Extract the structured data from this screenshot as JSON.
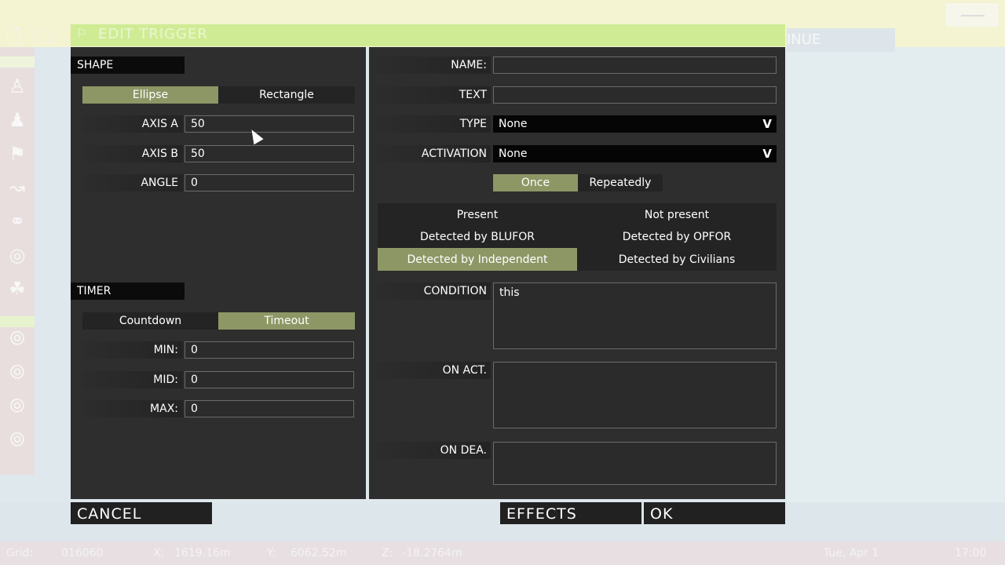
{
  "title": "EDIT TRIGGER",
  "continue_label": "INUE",
  "shape": {
    "header": "SHAPE",
    "toggle": [
      "Ellipse",
      "Rectangle"
    ],
    "axis_a": {
      "label": "AXIS A",
      "value": "50"
    },
    "axis_b": {
      "label": "AXIS B",
      "value": "50"
    },
    "angle": {
      "label": "ANGLE",
      "value": "0"
    }
  },
  "timer": {
    "header": "TIMER",
    "toggle": [
      "Countdown",
      "Timeout"
    ],
    "min": {
      "label": "MIN:",
      "value": "0"
    },
    "mid": {
      "label": "MID:",
      "value": "0"
    },
    "max": {
      "label": "MAX:",
      "value": "0"
    }
  },
  "right": {
    "name": {
      "label": "NAME:",
      "value": ""
    },
    "text": {
      "label": "TEXT",
      "value": ""
    },
    "type": {
      "label": "TYPE",
      "value": "None"
    },
    "activation": {
      "label": "ACTIVATION",
      "value": "None"
    },
    "repeat_toggle": [
      "Once",
      "Repeatedly"
    ],
    "conditions": [
      "Present",
      "Not present",
      "Detected by BLUFOR",
      "Detected by OPFOR",
      "Detected by Independent",
      "Detected by Civilians"
    ],
    "condition": {
      "label": "CONDITION",
      "value": "this"
    },
    "on_act": {
      "label": "ON ACT.",
      "value": ""
    },
    "on_dea": {
      "label": "ON DEA.",
      "value": ""
    }
  },
  "buttons": {
    "cancel": "CANCEL",
    "effects": "EFFECTS",
    "ok": "OK"
  },
  "status": {
    "grid_label": "Grid:",
    "grid_value": "016060",
    "x_label": "X:",
    "x_value": "1619.16m",
    "y_label": "Y:",
    "y_value": "6062.52m",
    "z_label": "Z:",
    "z_value": "-18.2764m",
    "date": "Tue, Apr 1",
    "time": "17:00"
  },
  "colors": {
    "selected": "#8d9766",
    "panel": "#2d2e2d",
    "header": "#0b0b0b"
  }
}
